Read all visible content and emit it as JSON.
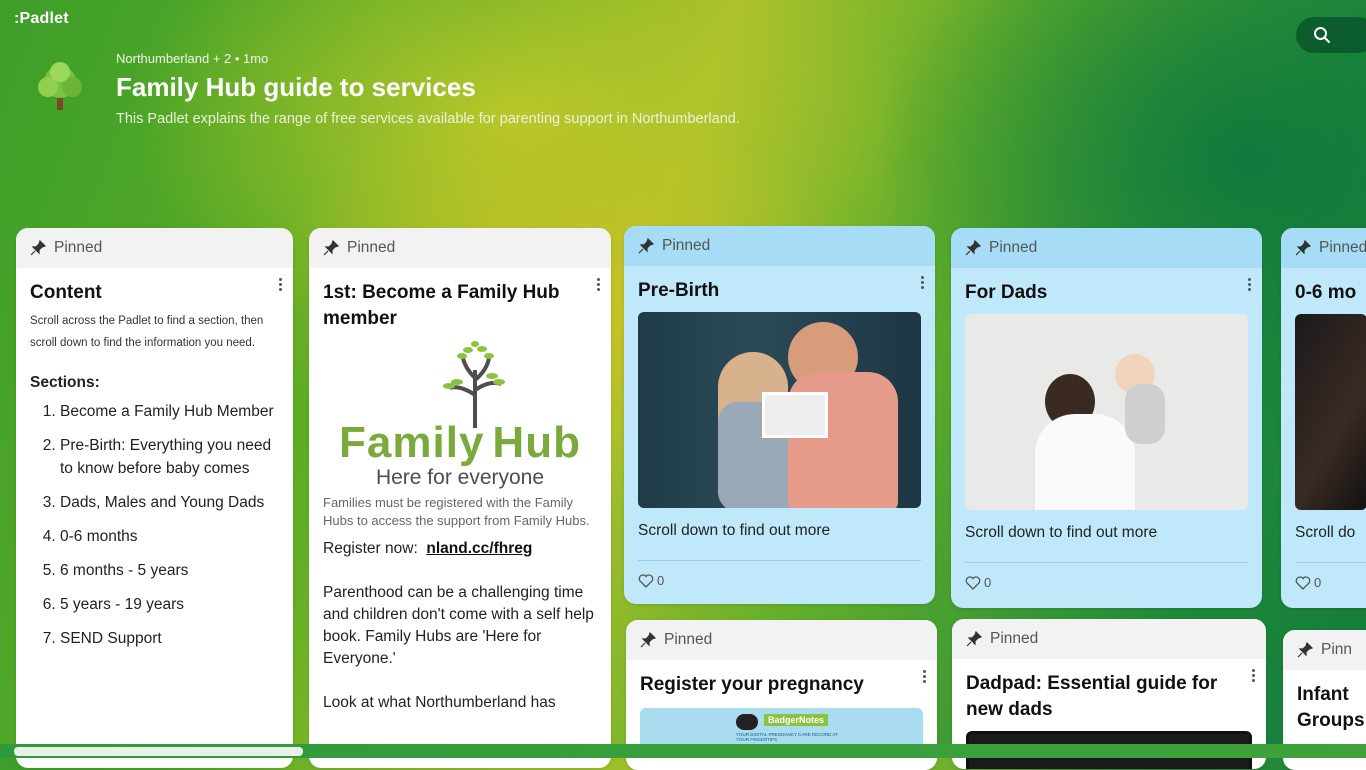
{
  "brand": ":Padlet",
  "header": {
    "meta": "Northumberland + 2 • 1mo",
    "title": "Family Hub guide to services",
    "subtitle": "This Padlet explains the range of free services available for parenting support in Northumberland."
  },
  "pinned_label": "Pinned",
  "cards": {
    "content": {
      "title": "Content",
      "intro": "Scroll across the Padlet to find a section, then scroll down to find the information you need.",
      "sections_heading": "Sections:",
      "sections": [
        "Become a Family Hub Member",
        "Pre-Birth: Everything you need to know before baby comes",
        "Dads, Males and Young Dads",
        "0-6 months",
        "6 months - 5 years",
        "5 years - 19 years",
        "SEND Support"
      ]
    },
    "member": {
      "title": "1st: Become a Family Hub member",
      "logo_word_left": "Family",
      "logo_word_right": "Hub",
      "logo_tagline": "Here for everyone",
      "note": "Families must be registered with the Family Hubs to access the support from Family Hubs.",
      "register_prefix": "Register now:",
      "register_link": "nland.cc/fhreg",
      "paragraph": "Parenthood can be a challenging time and  children don't come with a self help book. Family Hubs are 'Here for Everyone.'",
      "paragraph2": "Look at what Northumberland has"
    },
    "prebirth": {
      "title": "Pre-Birth",
      "caption": "Scroll down to find out more",
      "likes": "0"
    },
    "dads": {
      "title": "For Dads",
      "caption": "Scroll down to find out more",
      "likes": "0"
    },
    "zero_six": {
      "title": "0-6 mo",
      "caption": "Scroll do",
      "likes": "0"
    },
    "register_pregnancy": {
      "title": "Register your pregnancy",
      "badge": "BadgerNotes",
      "badge_sub": "YOUR DIGITAL PREGNANCY CARE RECORD AT YOUR FINGERTIPS"
    },
    "dadpad": {
      "title": "Dadpad: Essential guide for new dads"
    },
    "infant": {
      "title": "Infant Groups",
      "pinned_partial": "Pinn"
    }
  },
  "icons": [
    "padlet-logo",
    "tree-avatar-icon",
    "search-icon",
    "pin-icon",
    "more-dots-icon",
    "heart-icon"
  ]
}
